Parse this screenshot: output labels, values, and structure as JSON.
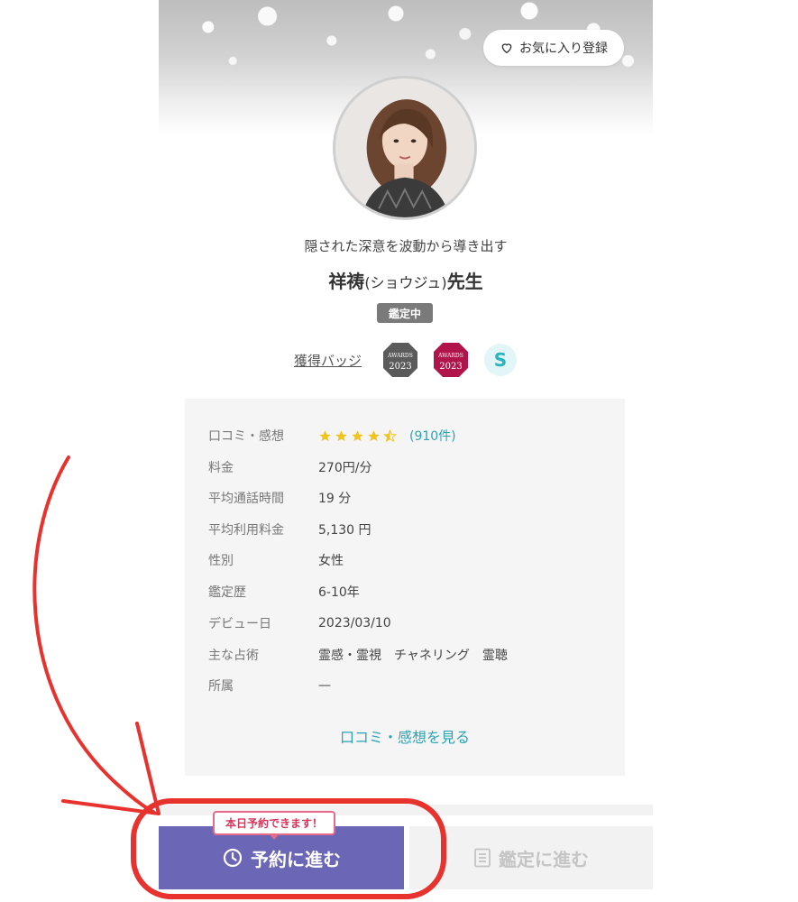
{
  "header": {
    "favorite_label": "お気に入り登録",
    "favorite_icon": "heart-outline-icon"
  },
  "profile": {
    "tagline": "隠された深意を波動から導き出す",
    "name": "祥祷",
    "name_kana": "(ショウジュ)",
    "honorific": "先生",
    "status": "鑑定中"
  },
  "badges": {
    "label": "獲得バッジ",
    "items": [
      {
        "name": "awards-2023-gray",
        "top": "AWARDS",
        "year": "2023",
        "color": "#5b5b5b"
      },
      {
        "name": "awards-2023-red",
        "top": "AWARDS",
        "year": "2023",
        "color": "#b0144a"
      },
      {
        "name": "s-badge",
        "letter": "S",
        "color": "#2bb3c0"
      }
    ]
  },
  "info": {
    "reviews_label": "口コミ・感想",
    "rating": 4.5,
    "review_count": "(910件)",
    "rows": [
      {
        "key": "料金",
        "value": "270円/分"
      },
      {
        "key": "平均通話時間",
        "value": "19 分"
      },
      {
        "key": "平均利用料金",
        "value": "5,130 円"
      },
      {
        "key": "性別",
        "value": "女性"
      },
      {
        "key": "鑑定歴",
        "value": "6-10年"
      },
      {
        "key": "デビュー日",
        "value": "2023/03/10"
      },
      {
        "key": "主な占術",
        "value": "霊感・霊視　チャネリング　霊聴"
      },
      {
        "key": "所属",
        "value": "—"
      }
    ],
    "reviews_link": "口コミ・感想を見る"
  },
  "actions": {
    "bubble": "本日予約できます！",
    "reserve_label": "予約に進む",
    "reserve_icon": "clock-icon",
    "consult_label": "鑑定に進む",
    "consult_icon": "document-icon"
  },
  "colors": {
    "accent": "#6b66b5",
    "link": "#2aa3b5",
    "star": "#f0c419",
    "annotation": "#e8322e"
  }
}
